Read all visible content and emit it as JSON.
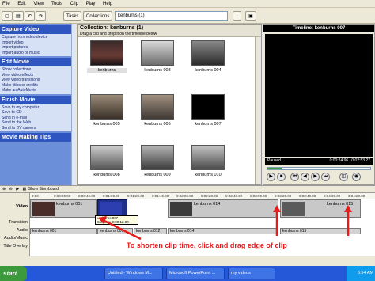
{
  "menu": [
    "File",
    "Edit",
    "View",
    "Tools",
    "Clip",
    "Play",
    "Help"
  ],
  "toolbar": {
    "tasks": "Tasks",
    "collections": "Collections",
    "collection_value": "kenburns (1)"
  },
  "taskpane": {
    "sections": [
      {
        "title": "Capture Video",
        "items": [
          "Capture from video device",
          "Import video",
          "Import pictures",
          "Import audio or music"
        ]
      },
      {
        "title": "Edit Movie",
        "items": [
          "Show collections",
          "View video effects",
          "View video transitions",
          "Make titles or credits",
          "Make an AutoMovie"
        ]
      },
      {
        "title": "Finish Movie",
        "items": [
          "Save to my computer",
          "Save to CD",
          "Send in e-mail",
          "Send to the Web",
          "Send to DV camera"
        ]
      },
      {
        "title": "Movie Making Tips",
        "items": []
      }
    ]
  },
  "collection": {
    "title": "Collection: kenburns (1)",
    "subtitle": "Drag a clip and drop it on the timeline below.",
    "clips": [
      "kenburns",
      "kenburns 003",
      "kenburns 004",
      "kenburns 005",
      "kenburns 006",
      "kenburns 007",
      "kenburns 008",
      "kenburns 009",
      "kenburns 010"
    ]
  },
  "monitor": {
    "title": "Timeline: kenburns 007",
    "status": "Paused",
    "time": "0:00:24.96 / 0:02:53.27"
  },
  "timeline": {
    "toggle": "Show Storyboard",
    "ruler": [
      "0:00",
      "0:00:20.00",
      "0:00:40.00",
      "0:01:00.00",
      "0:01:20.00",
      "0:01:40.00",
      "0:02:00.00",
      "0:02:20.00",
      "0:02:40.00",
      "0:03:00.00",
      "0:03:20.00",
      "0:03:40.00",
      "0:04:00.00",
      "0:04:20.00"
    ],
    "track_labels": [
      "Video",
      "Transition",
      "Audio",
      "Audio/Music",
      "Title Overlay"
    ],
    "video_clips": [
      "kenburns 001",
      "",
      "kenburns 014",
      "kenburns 015"
    ],
    "audio_clips": [
      "kenburns 001",
      "kenburns 007",
      "kenburns 012",
      "kenburns 014",
      "kenburns 015"
    ],
    "tooltip": [
      "kenburns 007",
      "Duration: 0:00:12.00"
    ]
  },
  "annotation": "To shorten clip time, click and drag edge of clip",
  "taskbar": {
    "start": "start",
    "tasks": [
      "Untitled - Windows M...",
      "Microsoft PowerPoint ...",
      "my videos"
    ],
    "clock": "6:54 AM"
  }
}
